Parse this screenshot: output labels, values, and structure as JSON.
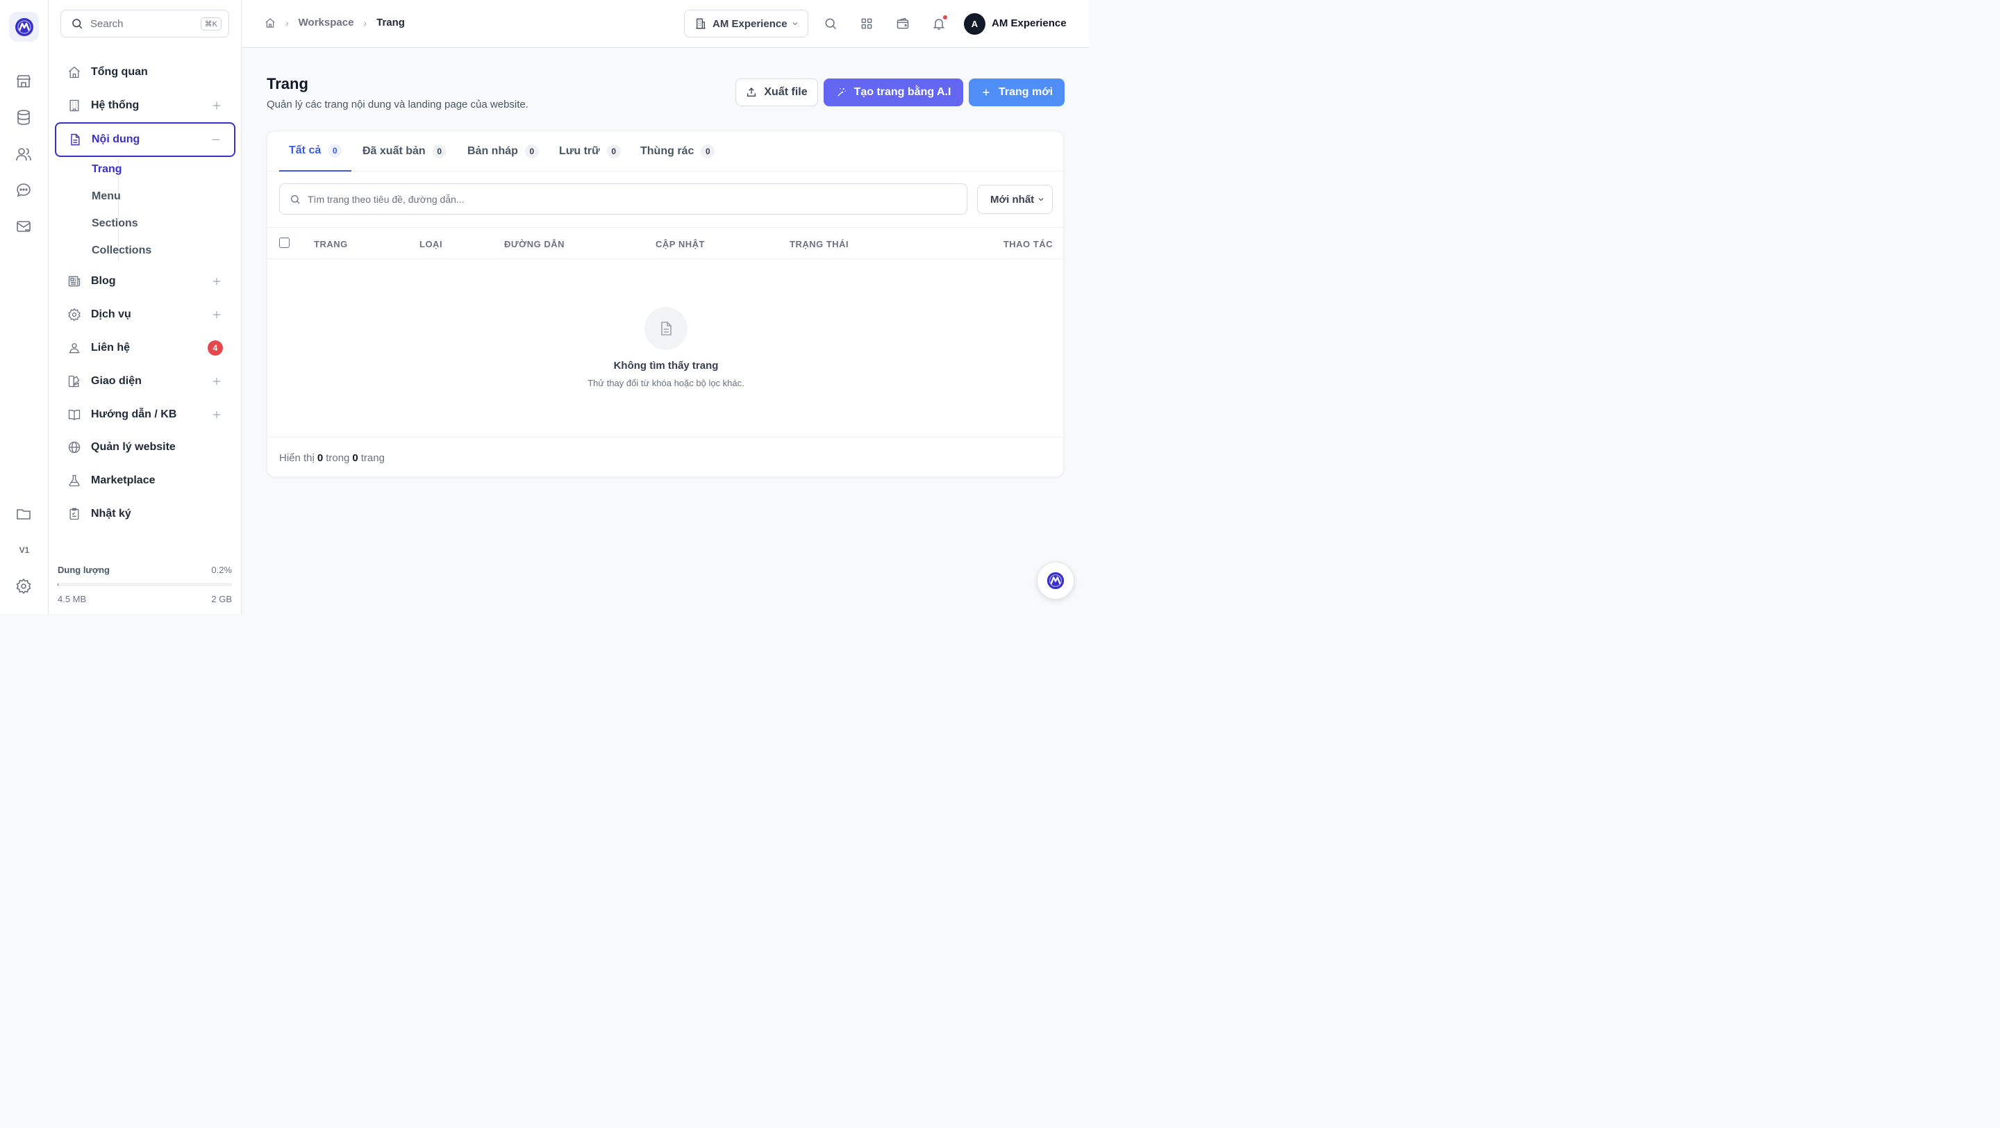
{
  "sidebar": {
    "search_placeholder": "Search",
    "search_shortcut": "⌘K",
    "items": [
      {
        "label": "Tổng quan"
      },
      {
        "label": "Hệ thống"
      },
      {
        "label": "Nội dung"
      },
      {
        "label": "Blog"
      },
      {
        "label": "Dịch vụ"
      },
      {
        "label": "Liên hệ",
        "badge": "4"
      },
      {
        "label": "Giao diện"
      },
      {
        "label": "Hướng dẫn / KB"
      },
      {
        "label": "Quản lý website"
      },
      {
        "label": "Marketplace"
      },
      {
        "label": "Nhật ký"
      }
    ],
    "subitems": [
      "Trang",
      "Menu",
      "Sections",
      "Collections"
    ],
    "storage": {
      "label": "Dung lượng",
      "percent_text": "0.2%",
      "percent": 0.2,
      "used": "4.5 MB",
      "total": "2 GB"
    }
  },
  "rail": {
    "version": "V1"
  },
  "breadcrumb": [
    "Workspace",
    "Trang"
  ],
  "topbar": {
    "workspace": "AM Experience",
    "avatar_initial": "A",
    "user_name": "AM Experience"
  },
  "page": {
    "title": "Trang",
    "subtitle": "Quản lý các trang nội dung và landing page của website.",
    "export_label": "Xuất file",
    "ai_label": "Tạo trang bằng A.I",
    "new_label": "Trang mới"
  },
  "tabs": [
    {
      "label": "Tất cả",
      "count": "0"
    },
    {
      "label": "Đã xuất bản",
      "count": "0"
    },
    {
      "label": "Bản nháp",
      "count": "0"
    },
    {
      "label": "Lưu trữ",
      "count": "0"
    },
    {
      "label": "Thùng rác",
      "count": "0"
    }
  ],
  "filter": {
    "search_placeholder": "Tìm trang theo tiêu đề, đường dẫn...",
    "sort_value": "Mới nhất"
  },
  "table": {
    "headers": [
      "TRANG",
      "LOẠI",
      "ĐƯỜNG DẪN",
      "CẬP NHẬT",
      "TRẠNG THÁI",
      "THAO TÁC"
    ]
  },
  "empty": {
    "title": "Không tìm thấy trang",
    "subtitle": "Thử thay đổi từ khóa hoặc bộ lọc khác."
  },
  "footer": {
    "prefix": "Hiển thị",
    "shown": "0",
    "middle": "trong",
    "total": "0",
    "suffix": "trang"
  },
  "colors": {
    "accent": "#3b2fc9",
    "ai_button": "#6366f1",
    "new_button": "#4f8ef7",
    "badge": "#e5484d"
  }
}
